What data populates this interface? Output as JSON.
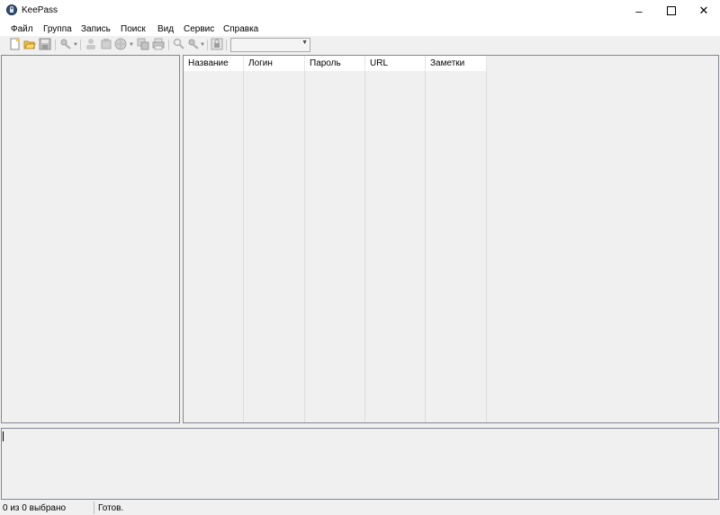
{
  "window": {
    "title": "KeePass"
  },
  "menu": [
    "Файл",
    "Группа",
    "Запись",
    "Поиск",
    "Вид",
    "Сервис",
    "Справка"
  ],
  "toolbar": {
    "icons": [
      "new-database-icon",
      "open-database-icon",
      "save-icon",
      "add-entry-icon",
      "copy-username-icon",
      "copy-password-icon",
      "open-url-icon",
      "duplicate-icon",
      "print-icon",
      "find-icon",
      "entries-icon",
      "lock-icon"
    ],
    "quickfind_value": ""
  },
  "entries": {
    "columns": [
      "Название",
      "Логин",
      "Пароль",
      "URL",
      "Заметки"
    ]
  },
  "status": {
    "selection": "0 из 0 выбрано",
    "state": "Готов."
  }
}
